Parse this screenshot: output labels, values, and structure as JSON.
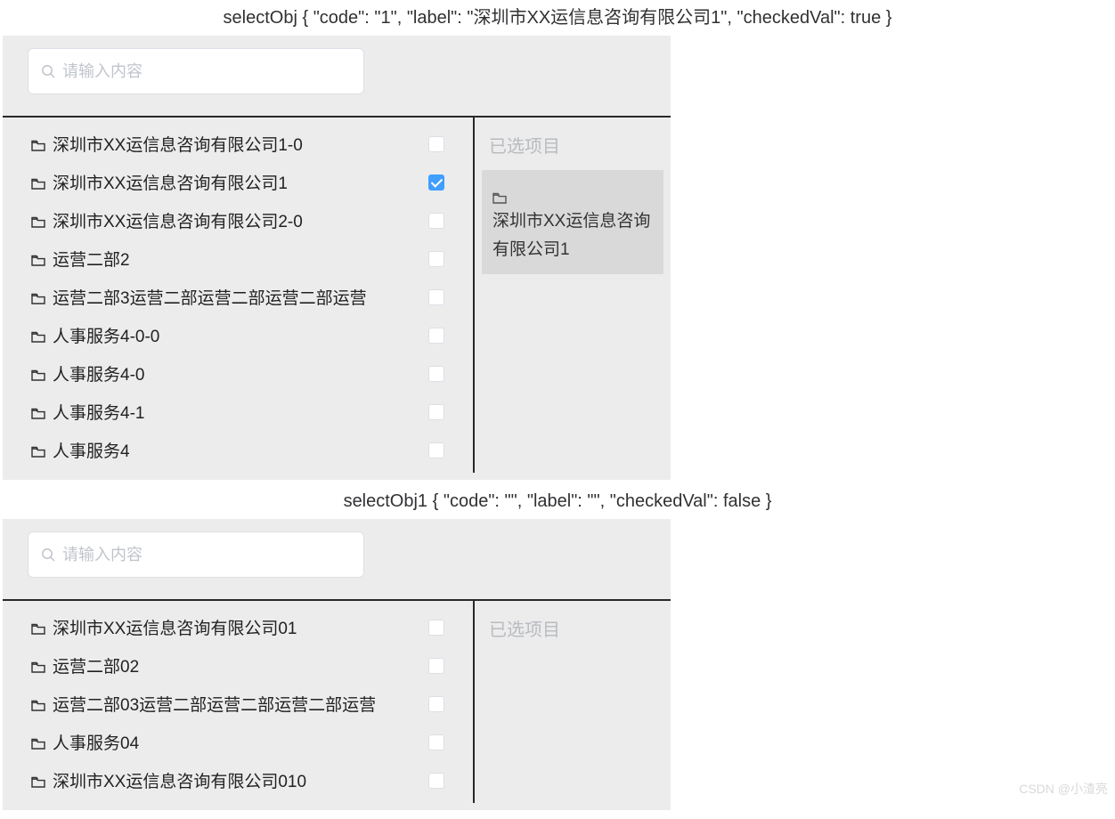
{
  "debug1": "selectObj { \"code\": \"1\", \"label\": \"深圳市XX运信息咨询有限公司1\", \"checkedVal\": true }",
  "debug2": "selectObj1 { \"code\": \"\", \"label\": \"\", \"checkedVal\": false }",
  "watermark": "CSDN @小渣亮",
  "panel1": {
    "search": {
      "placeholder": "请输入内容"
    },
    "selected_header": "已选项目",
    "items": [
      {
        "label": "深圳市XX运信息咨询有限公司1-0",
        "checked": false
      },
      {
        "label": "深圳市XX运信息咨询有限公司1",
        "checked": true
      },
      {
        "label": "深圳市XX运信息咨询有限公司2-0",
        "checked": false
      },
      {
        "label": "运营二部2",
        "checked": false
      },
      {
        "label": "运营二部3运营二部运营二部运营二部运营",
        "checked": false
      },
      {
        "label": "人事服务4-0-0",
        "checked": false
      },
      {
        "label": "人事服务4-0",
        "checked": false
      },
      {
        "label": "人事服务4-1",
        "checked": false
      },
      {
        "label": "人事服务4",
        "checked": false
      }
    ],
    "selected": [
      {
        "label": "深圳市XX运信息咨询有限公司1"
      }
    ]
  },
  "panel2": {
    "search": {
      "placeholder": "请输入内容"
    },
    "selected_header": "已选项目",
    "items": [
      {
        "label": "深圳市XX运信息咨询有限公司01",
        "checked": false
      },
      {
        "label": "运营二部02",
        "checked": false
      },
      {
        "label": "运营二部03运营二部运营二部运营二部运营",
        "checked": false
      },
      {
        "label": "人事服务04",
        "checked": false
      },
      {
        "label": "深圳市XX运信息咨询有限公司010",
        "checked": false
      }
    ],
    "selected": []
  }
}
